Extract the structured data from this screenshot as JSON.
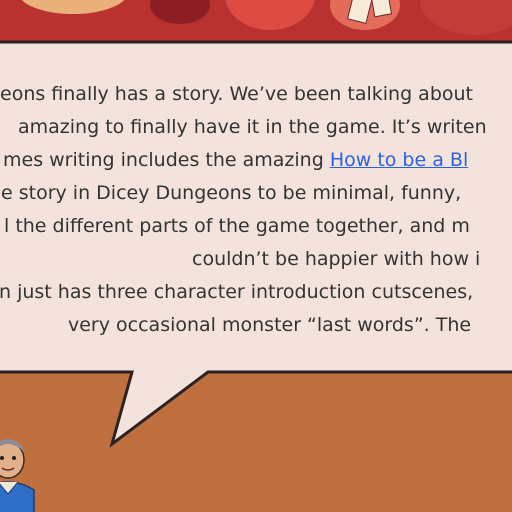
{
  "article": {
    "lines": [
      {
        "pre": "eons finally has a story. We’ve been talking about",
        "link": "",
        "post": ""
      },
      {
        "pre": "amazing to finally have it in the game. It’s writen",
        "link": "",
        "post": ""
      },
      {
        "pre": "mes writing includes the amazing ",
        "link": "How to be a Bl",
        "post": ""
      },
      {
        "pre": "e story in Dicey Dungeons to be minimal, funny,",
        "link": "",
        "post": ""
      },
      {
        "pre": "l the different parts of the game together, and m",
        "link": "",
        "post": ""
      },
      {
        "pre": "couldn’t be happier with how i",
        "link": "",
        "post": ""
      },
      {
        "pre": "n just has three character introduction cutscenes,",
        "link": "",
        "post": ""
      },
      {
        "pre": "very occasional monster “last words”. The",
        "link": "",
        "post": ""
      }
    ]
  },
  "colors": {
    "background": "#c0703e",
    "bubble_fill": "#f3e3dc",
    "bubble_border": "#2b2222",
    "text": "#333333",
    "link": "#2d63d8",
    "banner": "#b9322f"
  }
}
